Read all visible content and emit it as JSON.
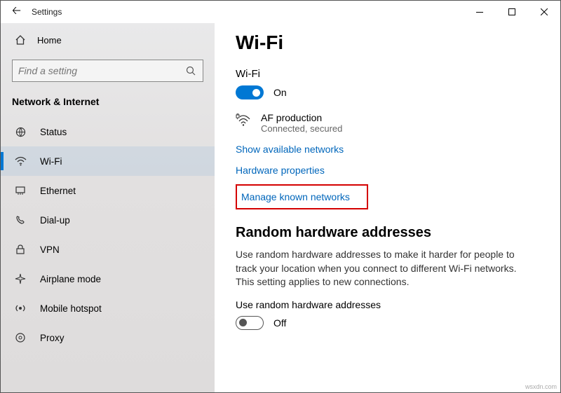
{
  "title": "Settings",
  "home_label": "Home",
  "search_placeholder": "Find a setting",
  "section": "Network & Internet",
  "nav": [
    {
      "label": "Status"
    },
    {
      "label": "Wi-Fi"
    },
    {
      "label": "Ethernet"
    },
    {
      "label": "Dial-up"
    },
    {
      "label": "VPN"
    },
    {
      "label": "Airplane mode"
    },
    {
      "label": "Mobile hotspot"
    },
    {
      "label": "Proxy"
    }
  ],
  "page": {
    "heading": "Wi-Fi",
    "wifi_label": "Wi-Fi",
    "wifi_toggle": "On",
    "network_name": "AF production",
    "network_status": "Connected, secured",
    "link_show": "Show available networks",
    "link_hw": "Hardware properties",
    "link_manage": "Manage known networks",
    "rand_heading": "Random hardware addresses",
    "rand_text": "Use random hardware addresses to make it harder for people to track your location when you connect to different Wi-Fi networks. This setting applies to new connections.",
    "rand_label": "Use random hardware addresses",
    "rand_toggle": "Off"
  },
  "attribution": "wsxdn.com"
}
